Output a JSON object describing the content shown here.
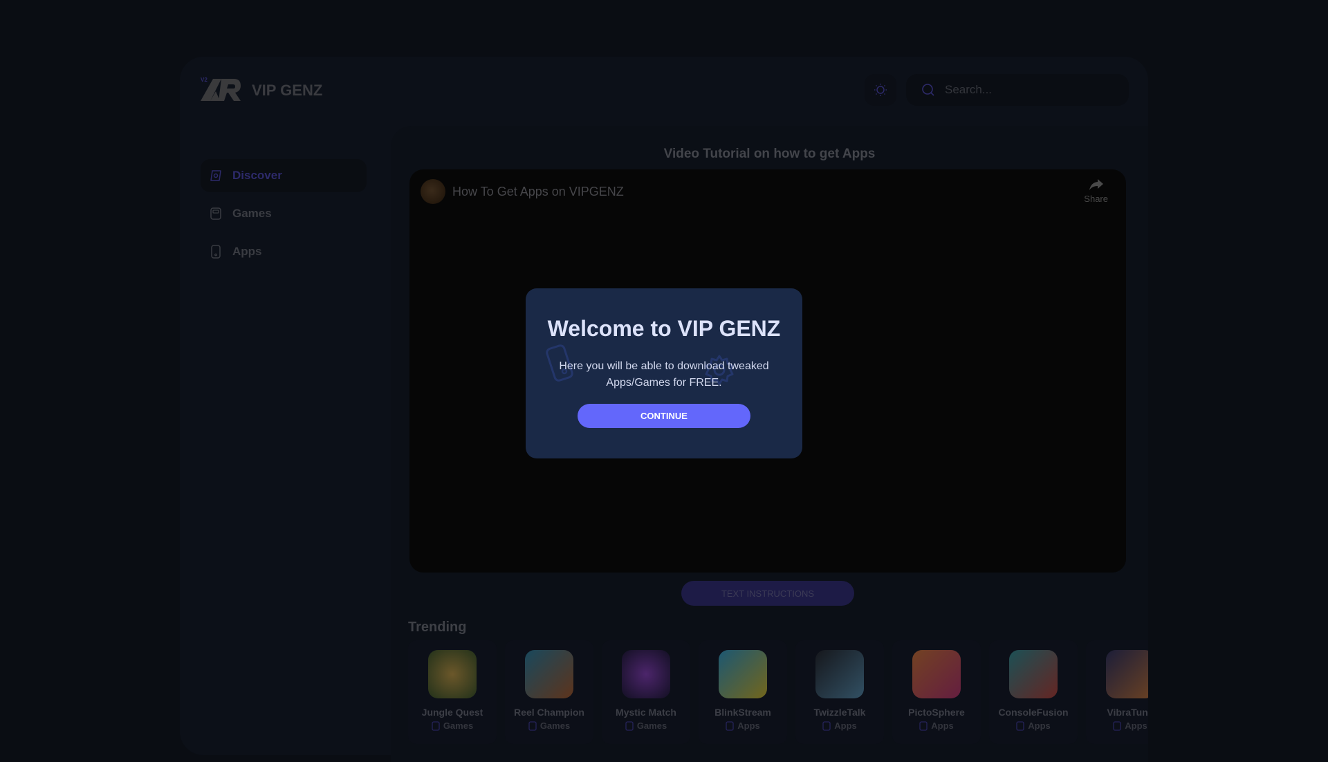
{
  "header": {
    "logo_badge": "V2",
    "brand": "VIP GENZ",
    "search_placeholder": "Search..."
  },
  "sidebar": {
    "items": [
      {
        "label": "Discover",
        "icon": "compass-icon",
        "active": true
      },
      {
        "label": "Games",
        "icon": "gamepad-icon"
      },
      {
        "label": "Apps",
        "icon": "phone-icon"
      }
    ]
  },
  "main": {
    "video_section_title": "Video Tutorial on how to get Apps",
    "video": {
      "title": "How To Get Apps on VIPGENZ",
      "share_label": "Share"
    },
    "text_instructions_label": "TEXT INSTRUCTIONS",
    "trending_title": "Trending",
    "trending": [
      {
        "name": "Jungle Quest",
        "category": "Games"
      },
      {
        "name": "Reel Champion",
        "category": "Games"
      },
      {
        "name": "Mystic Match",
        "category": "Games"
      },
      {
        "name": "BlinkStream",
        "category": "Apps"
      },
      {
        "name": "TwizzleTalk",
        "category": "Apps"
      },
      {
        "name": "PictoSphere",
        "category": "Apps"
      },
      {
        "name": "ConsoleFusion",
        "category": "Apps"
      },
      {
        "name": "VibraTune",
        "category": "Apps"
      }
    ]
  },
  "modal": {
    "title": "Welcome to VIP GENZ",
    "body": "Here you will be able to download tweaked Apps/Games for FREE.",
    "continue_label": "CONTINUE"
  },
  "colors": {
    "accent": "#6367fb",
    "modal_bg": "#1a2947",
    "page_bg": "#0a0d13"
  }
}
